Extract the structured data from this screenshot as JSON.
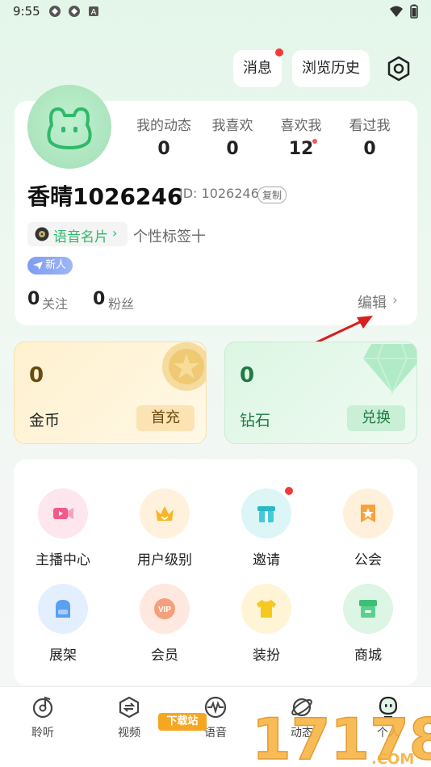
{
  "status_bar": {
    "time": "9:55",
    "icons": [
      "app-icon",
      "app-icon",
      "a-letter-icon"
    ],
    "right_icons": [
      "wifi-icon",
      "battery-icon"
    ]
  },
  "header": {
    "messages_label": "消息",
    "history_label": "浏览历史"
  },
  "profile": {
    "stats": [
      {
        "label": "我的动态",
        "value": "0"
      },
      {
        "label": "我喜欢",
        "value": "0"
      },
      {
        "label": "喜欢我",
        "value": "12"
      },
      {
        "label": "看过我",
        "value": "0"
      }
    ],
    "username": "香晴1026246",
    "user_id": "ID: 1026246",
    "copy_label": "复制",
    "voice_card_label": "语音名片",
    "tag_add_label": "个性标签十",
    "badge_label": "新人",
    "follow_count": "0",
    "follow_label": "关注",
    "fans_count": "0",
    "fans_label": "粉丝",
    "edit_label": "编辑"
  },
  "wallet": {
    "coins": {
      "value": "0",
      "label": "金币",
      "button": "首充"
    },
    "diamonds": {
      "value": "0",
      "label": "钻石",
      "button": "兑换"
    }
  },
  "grid": {
    "items": [
      {
        "label": "主播中心",
        "icon": "video-camera-icon"
      },
      {
        "label": "用户级别",
        "icon": "crown-icon"
      },
      {
        "label": "邀请",
        "icon": "gift-icon"
      },
      {
        "label": "公会",
        "icon": "star-badge-icon"
      },
      {
        "label": "展架",
        "icon": "backpack-icon"
      },
      {
        "label": "会员",
        "icon": "vip-icon"
      },
      {
        "label": "装扮",
        "icon": "shirt-icon"
      },
      {
        "label": "商城",
        "icon": "store-icon"
      }
    ]
  },
  "bottom_nav": {
    "items": [
      {
        "label": "聆听",
        "icon": "music-note-icon"
      },
      {
        "label": "视频",
        "icon": "video-swap-icon"
      },
      {
        "label": "语音",
        "icon": "waveform-icon"
      },
      {
        "label": "动态",
        "icon": "planet-icon"
      },
      {
        "label": "个人",
        "icon": "profile-icon"
      }
    ]
  },
  "watermark": {
    "text": "17178",
    "sub_text": ".COM",
    "box_text": "下载站"
  },
  "colors": {
    "accent_green": "#2fb96a",
    "notification_red": "#f03b3b",
    "coin_bg": "#fff1cf",
    "diamond_bg": "#dcf6e3"
  }
}
